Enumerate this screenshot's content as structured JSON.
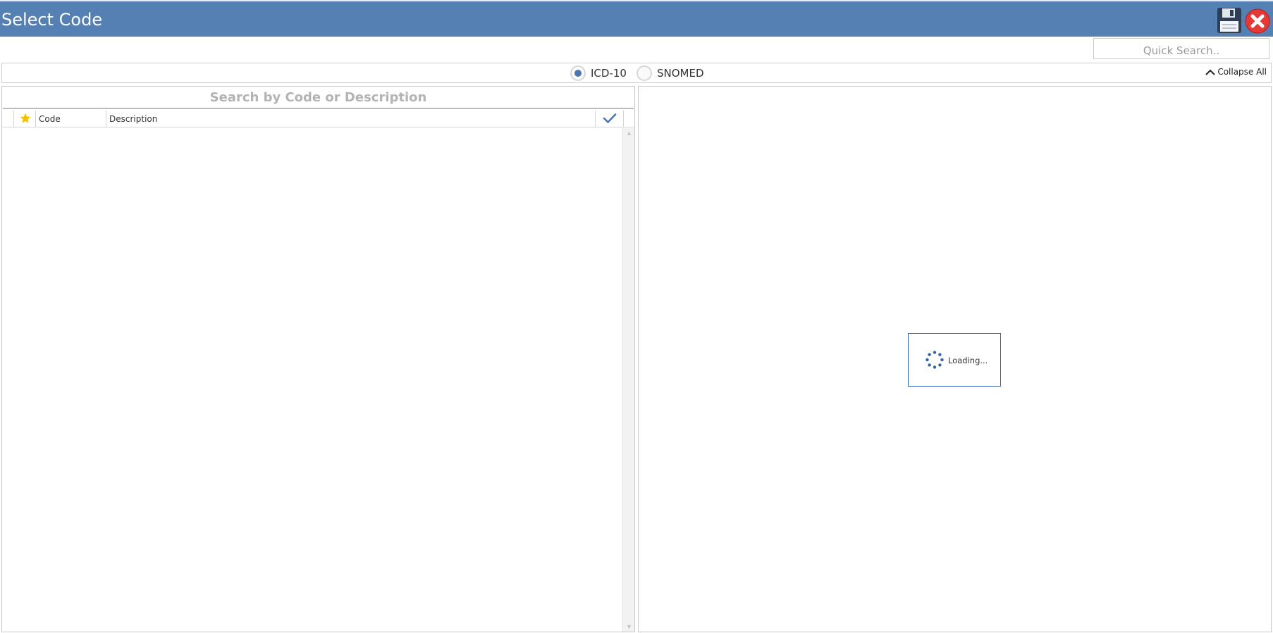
{
  "window": {
    "title": "Select Code",
    "icons": {
      "save": "save-icon",
      "close": "close-icon"
    }
  },
  "toolbar": {
    "quick_search_placeholder": "Quick Search.."
  },
  "filter": {
    "options": [
      {
        "label": "ICD-10",
        "selected": true
      },
      {
        "label": "SNOMED",
        "selected": false
      }
    ],
    "collapse_all_label": "Collapse All"
  },
  "code_list": {
    "search_placeholder": "Search by Code or Description",
    "columns": {
      "favorite_icon": "star-icon",
      "code": "Code",
      "description": "Description",
      "selected_icon": "checkmark-icon"
    },
    "rows": []
  },
  "detail_panel": {
    "loading_text": "Loading..."
  },
  "colors": {
    "titlebar": "#5580b3",
    "accent": "#4d76ae",
    "star": "#f5c400",
    "close": "#e53935"
  }
}
